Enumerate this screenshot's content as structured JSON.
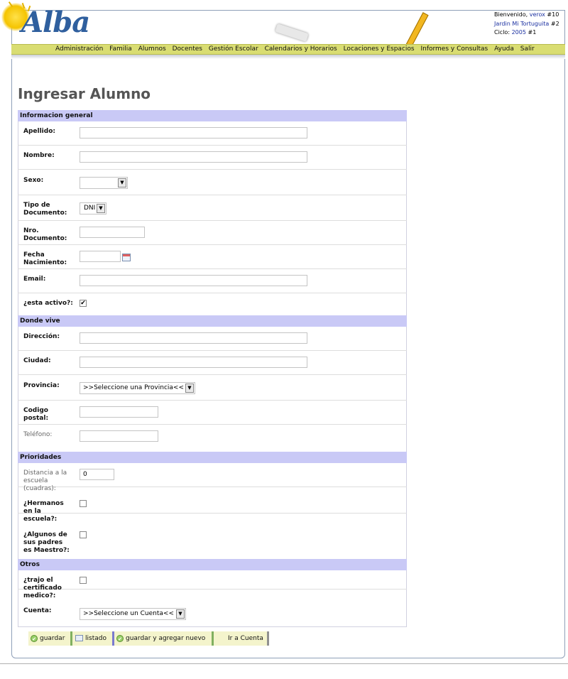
{
  "app": {
    "logo_text": "Alba",
    "welcome_prefix": "Bienvenido,",
    "user": "verox",
    "user_id": "#10",
    "school": "Jardin Mi Tortuguita",
    "school_id": "#2",
    "cycle_label": "Ciclo:",
    "cycle": "2005",
    "cycle_id": "#1"
  },
  "menu": [
    "Administración",
    "Familia",
    "Alumnos",
    "Docentes",
    "Gestión Escolar",
    "Calendarios y Horarios",
    "Locaciones y Espacios",
    "Informes y Consultas",
    "Ayuda",
    "Salir"
  ],
  "page_title": "Ingresar Alumno",
  "sections": {
    "general": "Informacion general",
    "donde_vive": "Donde vive",
    "prioridades": "Prioridades",
    "otros": "Otros"
  },
  "fields": {
    "apellido": {
      "label": "Apellido:",
      "value": ""
    },
    "nombre": {
      "label": "Nombre:",
      "value": ""
    },
    "sexo": {
      "label": "Sexo:",
      "value": ""
    },
    "tipo_documento": {
      "label_1": "Tipo de",
      "label_2": "Documento:",
      "value": "DNI"
    },
    "nro_documento": {
      "label_1": "Nro.",
      "label_2": "Documento:",
      "value": ""
    },
    "fecha_nacimiento": {
      "label_1": "Fecha",
      "label_2": "Nacimiento:",
      "value": ""
    },
    "email": {
      "label": "Email:",
      "value": ""
    },
    "activo": {
      "label": "¿esta activo?:",
      "checked": true
    },
    "direccion": {
      "label": "Dirección:",
      "value": ""
    },
    "ciudad": {
      "label": "Ciudad:",
      "value": ""
    },
    "provincia": {
      "label": "Provincia:",
      "value": ">>Seleccione una Provincia<<"
    },
    "codigo_postal": {
      "label_1": "Codigo",
      "label_2": "postal:",
      "value": ""
    },
    "telefono": {
      "label": "Teléfono:",
      "value": ""
    },
    "distancia": {
      "label_1": "Distancia a la",
      "label_2": "escuela",
      "label_3": "(cuadras):",
      "value": "0"
    },
    "hermanos": {
      "label_1": "¿Hermanos",
      "label_2": "en la",
      "label_3": "escuela?:",
      "checked": false
    },
    "padres_maestro": {
      "label_1": "¿Algunos de",
      "label_2": "sus padres",
      "label_3": "es Maestro?:",
      "checked": false
    },
    "certificado": {
      "label_1": "¿trajo el",
      "label_2": "certificado",
      "label_3": "medico?:",
      "checked": false
    },
    "cuenta": {
      "label": "Cuenta:",
      "value": ">>Seleccione un Cuenta<<"
    }
  },
  "buttons": {
    "guardar": "guardar",
    "listado": "listado",
    "guardar_nuevo": "guardar y agregar nuevo",
    "ir_cuenta": "Ir a Cuenta"
  },
  "colors": {
    "menu_bar": "#d9dd72",
    "section_header": "#c9c9f6",
    "link": "#1a2fa0"
  }
}
